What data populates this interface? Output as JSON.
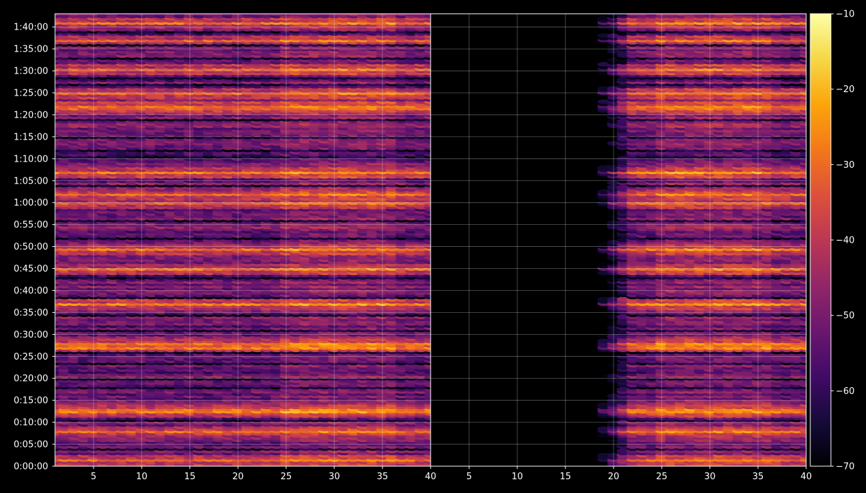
{
  "chart_data": {
    "type": "heatmap",
    "style": "dark_background",
    "colormap": "inferno",
    "grid": true,
    "y_axis": {
      "ylim_minutes": [
        0,
        103
      ],
      "tick_labels": [
        "0:00:00",
        "0:05:00",
        "0:10:00",
        "0:15:00",
        "0:20:00",
        "0:25:00",
        "0:30:00",
        "0:35:00",
        "0:40:00",
        "0:45:00",
        "0:50:00",
        "0:55:00",
        "1:00:00",
        "1:05:00",
        "1:10:00",
        "1:15:00",
        "1:20:00",
        "1:25:00",
        "1:30:00",
        "1:35:00",
        "1:40:00"
      ],
      "tick_minutes": [
        0,
        5,
        10,
        15,
        20,
        25,
        30,
        35,
        40,
        45,
        50,
        55,
        60,
        65,
        70,
        75,
        80,
        85,
        90,
        95,
        100
      ]
    },
    "panels": [
      {
        "name": "left",
        "xlim": [
          1,
          40
        ],
        "x_ticks": [
          5,
          10,
          15,
          20,
          25,
          30,
          35,
          40
        ],
        "x_tick_labels": [
          "5",
          "10",
          "15",
          "20",
          "25",
          "30",
          "35",
          "40"
        ],
        "signal_start_x": 1
      },
      {
        "name": "right",
        "xlim": [
          1,
          40
        ],
        "x_ticks": [
          5,
          10,
          15,
          20,
          25,
          30,
          35,
          40
        ],
        "x_tick_labels": [
          "5",
          "10",
          "15",
          "20",
          "25",
          "30",
          "35",
          "40"
        ],
        "signal_start_x": 22
      }
    ],
    "colorbar": {
      "range": [
        -70,
        -10
      ],
      "ticks": [
        -70,
        -60,
        -50,
        -40,
        -30,
        -20,
        -10
      ],
      "tick_labels": [
        "−70",
        "−60",
        "−50",
        "−40",
        "−30",
        "−20",
        "−10"
      ]
    },
    "strong_rows_minutes": [
      1.5,
      8,
      12.5,
      13,
      27,
      27.5,
      28,
      37,
      45,
      49.5,
      60,
      62,
      67,
      81.5,
      82,
      85,
      90.5,
      97,
      101
    ],
    "weak_rows_minutes": [
      4,
      10.5,
      18,
      20,
      23.5,
      26,
      31,
      34.5,
      38.5,
      43,
      52,
      56,
      64,
      70.5,
      72,
      75,
      79,
      87,
      88.5,
      93,
      96,
      99
    ]
  }
}
